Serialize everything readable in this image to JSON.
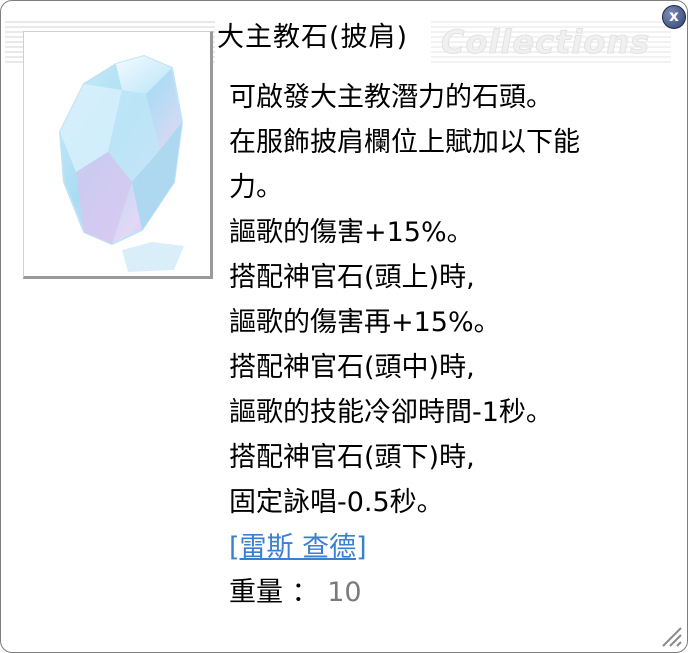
{
  "window": {
    "title": "大主教石(披肩)",
    "watermark": "Collections",
    "close_label": "x"
  },
  "item_image": {
    "icon": "crystal-stone-icon"
  },
  "description": {
    "lines": [
      "可啟發大主教潛力的石頭。",
      "在服飾披肩欄位上賦加以下能",
      "力。",
      "謳歌的傷害+15%。",
      "搭配神官石(頭上)時,",
      "謳歌的傷害再+15%。",
      "搭配神官石(頭中)時,",
      "謳歌的技能冷卻時間-1秒。",
      "搭配神官石(頭下)時,",
      "固定詠唱-0.5秒。"
    ],
    "link_label": "[雷斯 查德]",
    "weight_label": "重量 ：",
    "weight_value": "10"
  },
  "colors": {
    "link": "#3a7fd0",
    "weight_value": "#7a7a7a",
    "border": "#7f7f7f"
  }
}
